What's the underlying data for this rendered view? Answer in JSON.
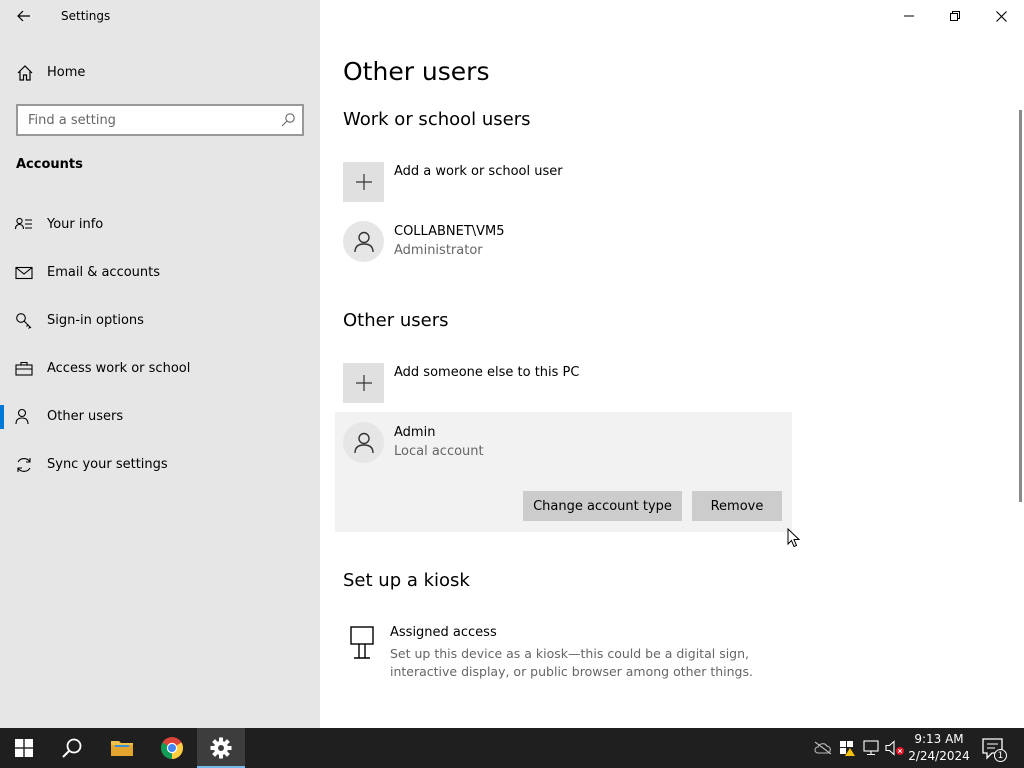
{
  "window": {
    "title": "Settings",
    "back_icon": "back-arrow-icon"
  },
  "sidebar": {
    "home_label": "Home",
    "search_placeholder": "Find a setting",
    "section_label": "Accounts",
    "items": [
      {
        "label": "Your info",
        "icon": "person-card-icon"
      },
      {
        "label": "Email & accounts",
        "icon": "mail-icon"
      },
      {
        "label": "Sign-in options",
        "icon": "key-icon"
      },
      {
        "label": "Access work or school",
        "icon": "briefcase-icon"
      },
      {
        "label": "Other users",
        "icon": "person-icon",
        "active": true
      },
      {
        "label": "Sync your settings",
        "icon": "sync-icon"
      }
    ]
  },
  "main": {
    "page_title": "Other users",
    "work_section": {
      "heading": "Work or school users",
      "add_label": "Add a work or school user",
      "user": {
        "name": "COLLABNET\\VM5",
        "role": "Administrator"
      }
    },
    "other_section": {
      "heading": "Other users",
      "add_label": "Add someone else to this PC",
      "user": {
        "name": "Admin",
        "role": "Local account"
      },
      "change_button": "Change account type",
      "remove_button": "Remove"
    },
    "kiosk_section": {
      "heading": "Set up a kiosk",
      "title": "Assigned access",
      "description": "Set up this device as a kiosk—this could be a digital sign, interactive display, or public browser among other things."
    }
  },
  "taskbar": {
    "time": "9:13 AM",
    "date": "2/24/2024",
    "notification_count": "1"
  },
  "colors": {
    "accent": "#0078d7",
    "sidebar_bg": "#e6e6e6",
    "taskbar_bg": "#1f1f1f"
  }
}
